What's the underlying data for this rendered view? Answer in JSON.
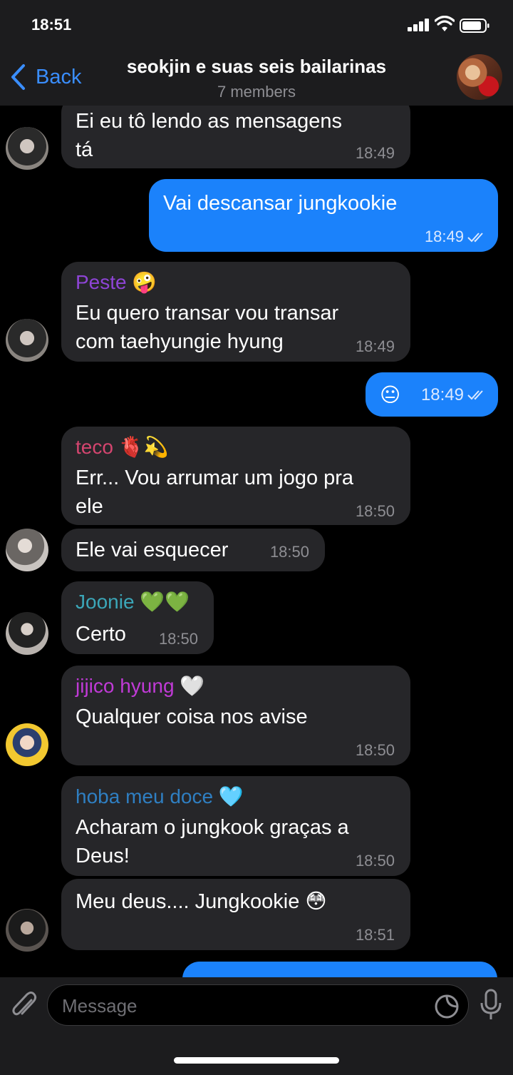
{
  "status_bar": {
    "time": "18:51"
  },
  "header": {
    "back_label": "Back",
    "title": "seokjin e suas seis bailarinas",
    "subtitle": "7 members"
  },
  "messages": [
    {
      "text": [
        "Ei eu tô lendo as mensagens",
        "tá"
      ],
      "time": "18:49"
    },
    {
      "text": [
        "Vai descansar jungkookie"
      ],
      "time": "18:49"
    },
    {
      "sender": "Peste",
      "sender_emoji": "🤪",
      "sender_color": "#8e44d6",
      "text": [
        "Eu quero transar vou transar",
        "com taehyungie hyung"
      ],
      "time": "18:49"
    },
    {
      "text": [
        "😐"
      ],
      "time": "18:49"
    },
    {
      "sender": "teco",
      "sender_emoji": "🫀💫",
      "sender_color": "#d4456f",
      "text": [
        "Err... Vou arrumar um jogo pra",
        "ele"
      ],
      "time": "18:50"
    },
    {
      "text": [
        "Ele vai esquecer"
      ],
      "time": "18:50"
    },
    {
      "sender": "Joonie",
      "sender_emoji": "💚💚",
      "sender_color": "#3ba6b8",
      "text": [
        "Certo"
      ],
      "time": "18:50"
    },
    {
      "sender": "jijico hyung",
      "sender_emoji": "🤍",
      "sender_color": "#c03ad6",
      "text": [
        "Qualquer coisa nos avise"
      ],
      "time": "18:50"
    },
    {
      "sender": "hoba meu doce",
      "sender_emoji": "🩵",
      "sender_color": "#2f7fc2",
      "text": [
        "Acharam o jungkook graças a",
        "Deus!"
      ],
      "time": "18:50"
    },
    {
      "text": [
        "Meu deus.... Jungkookie 😳"
      ],
      "time": "18:51"
    }
  ],
  "input": {
    "placeholder": "Message"
  },
  "colors": {
    "accent": "#3a8eff",
    "outgoing_bubble": "#1b82fb",
    "incoming_bubble": "#262629",
    "background": "#000000"
  },
  "icons": [
    "signal-icon",
    "wifi-icon",
    "battery-icon",
    "back-chevron-icon",
    "paperclip-icon",
    "sticker-icon",
    "microphone-icon",
    "read-checkmarks-icon"
  ]
}
